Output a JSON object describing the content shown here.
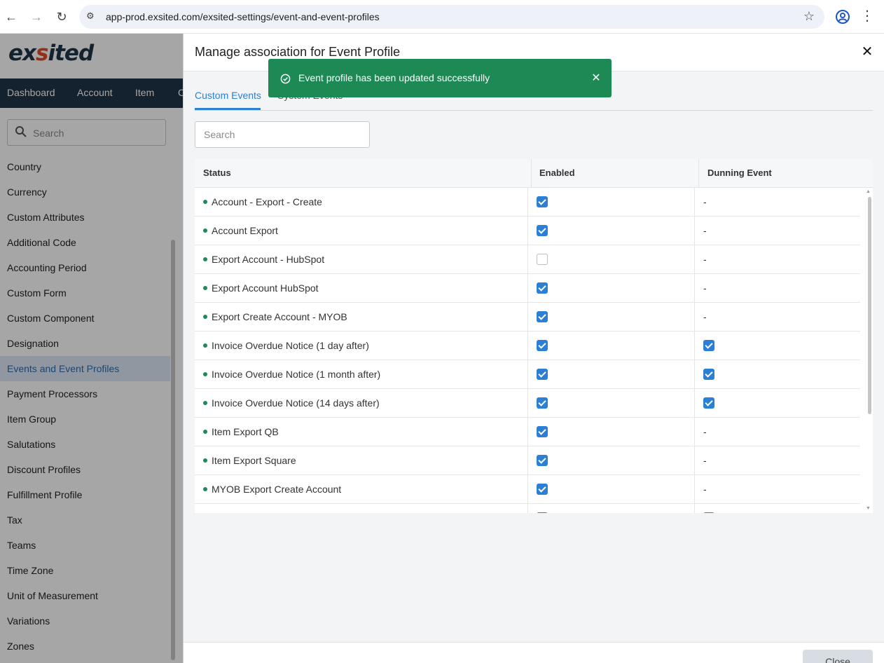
{
  "browser": {
    "url": "app-prod.exsited.com/exsited-settings/event-and-event-profiles"
  },
  "app": {
    "logo": {
      "part1": "ex",
      "part2": "s",
      "part3": "ited"
    },
    "topnav": [
      "Dashboard",
      "Account",
      "Item",
      "C"
    ],
    "search_placeholder": "Search",
    "sidebar_items": [
      {
        "label": "Country",
        "active": false
      },
      {
        "label": "Currency",
        "active": false
      },
      {
        "label": "Custom Attributes",
        "active": false
      },
      {
        "label": "Additional Code",
        "active": false
      },
      {
        "label": "Accounting Period",
        "active": false
      },
      {
        "label": "Custom Form",
        "active": false
      },
      {
        "label": "Custom Component",
        "active": false
      },
      {
        "label": "Designation",
        "active": false
      },
      {
        "label": "Events and Event Profiles",
        "active": true
      },
      {
        "label": "Payment Processors",
        "active": false
      },
      {
        "label": "Item Group",
        "active": false
      },
      {
        "label": "Salutations",
        "active": false
      },
      {
        "label": "Discount Profiles",
        "active": false
      },
      {
        "label": "Fulfillment Profile",
        "active": false
      },
      {
        "label": "Tax",
        "active": false
      },
      {
        "label": "Teams",
        "active": false
      },
      {
        "label": "Time Zone",
        "active": false
      },
      {
        "label": "Unit of Measurement",
        "active": false
      },
      {
        "label": "Variations",
        "active": false
      },
      {
        "label": "Zones",
        "active": false
      }
    ]
  },
  "modal": {
    "title": "Manage association for Event Profile",
    "close_glyph": "✕",
    "tabs": [
      {
        "label": "Custom Events",
        "active": true
      },
      {
        "label": "System Events",
        "active": false
      }
    ],
    "search_placeholder": "Search",
    "columns": [
      "Status",
      "Enabled",
      "Dunning Event"
    ],
    "rows": [
      {
        "name": "Account - Export - Create",
        "enabled": true,
        "dunning": null
      },
      {
        "name": "Account Export",
        "enabled": true,
        "dunning": null
      },
      {
        "name": "Export Account - HubSpot",
        "enabled": false,
        "dunning": null
      },
      {
        "name": "Export Account HubSpot",
        "enabled": true,
        "dunning": null
      },
      {
        "name": "Export Create Account - MYOB",
        "enabled": true,
        "dunning": null
      },
      {
        "name": "Invoice Overdue Notice (1 day after)",
        "enabled": true,
        "dunning": true
      },
      {
        "name": "Invoice Overdue Notice (1 month after)",
        "enabled": true,
        "dunning": true
      },
      {
        "name": "Invoice Overdue Notice (14 days after)",
        "enabled": true,
        "dunning": true
      },
      {
        "name": "Item Export QB",
        "enabled": true,
        "dunning": null
      },
      {
        "name": "Item Export Square",
        "enabled": true,
        "dunning": null
      },
      {
        "name": "MYOB Export Create Account",
        "enabled": true,
        "dunning": null
      },
      {
        "name": "",
        "enabled": true,
        "dunning": true
      }
    ],
    "dash": "-",
    "close_button": "Close"
  },
  "toast": {
    "message": "Event profile has been updated successfully",
    "close_glyph": "✕",
    "color": "#1d8a55"
  },
  "colors": {
    "accent": "#2b7fd4",
    "nav_bg": "#203447",
    "status_dot": "#1f8a57"
  }
}
